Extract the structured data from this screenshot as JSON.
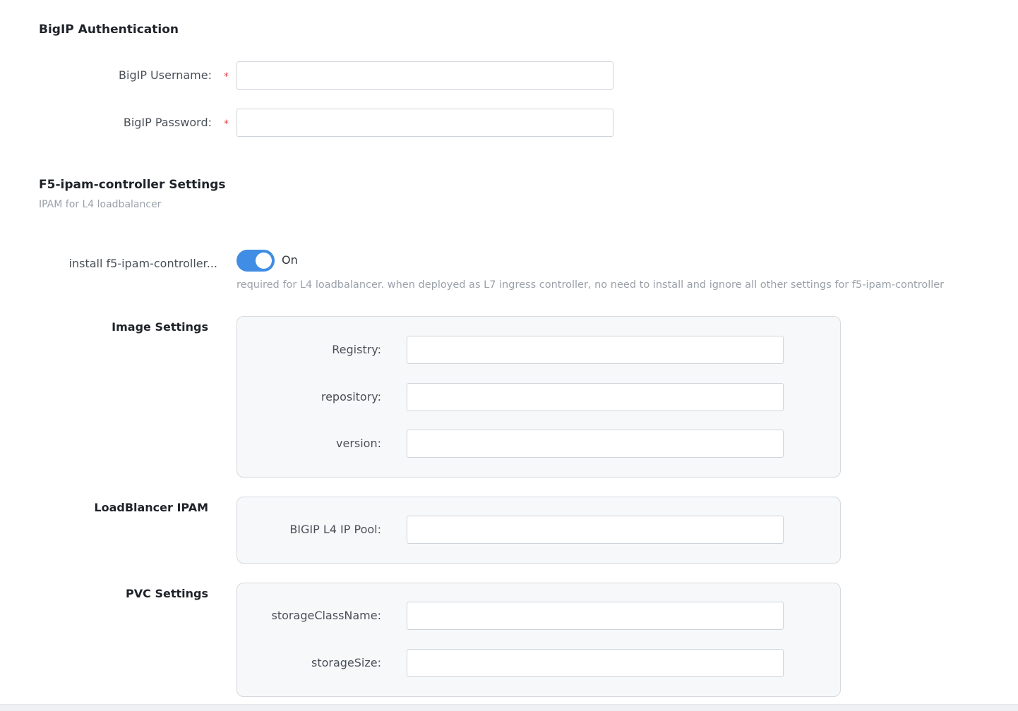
{
  "auth": {
    "title": "BigIP Authentication",
    "username_label": "BigIP Username:",
    "username_value": "",
    "password_label": "BigIP Password:",
    "password_value": "",
    "required_mark": "*"
  },
  "ipam": {
    "title": "F5-ipam-controller Settings",
    "subtitle": "IPAM for L4 loadbalancer",
    "install_label": "install f5-ipam-controller...",
    "install_state": "On",
    "install_enabled": true,
    "install_hint": "required for L4 loadbalancer. when deployed as L7 ingress controller, no need to install and ignore all other settings for f5-ipam-controller"
  },
  "image_settings": {
    "title": "Image Settings",
    "registry_label": "Registry:",
    "registry_value": "",
    "repository_label": "repository:",
    "repository_value": "",
    "version_label": "version:",
    "version_value": ""
  },
  "lb_ipam": {
    "title": "LoadBlancer IPAM",
    "pool_label": "BIGIP L4 IP Pool:",
    "pool_value": ""
  },
  "pvc": {
    "title": "PVC Settings",
    "storage_class_label": "storageClassName:",
    "storage_class_value": "",
    "storage_size_label": "storageSize:",
    "storage_size_value": ""
  },
  "colors": {
    "accent": "#3f8de4",
    "required": "#e0484f",
    "panel_bg": "#f7f8fa"
  }
}
